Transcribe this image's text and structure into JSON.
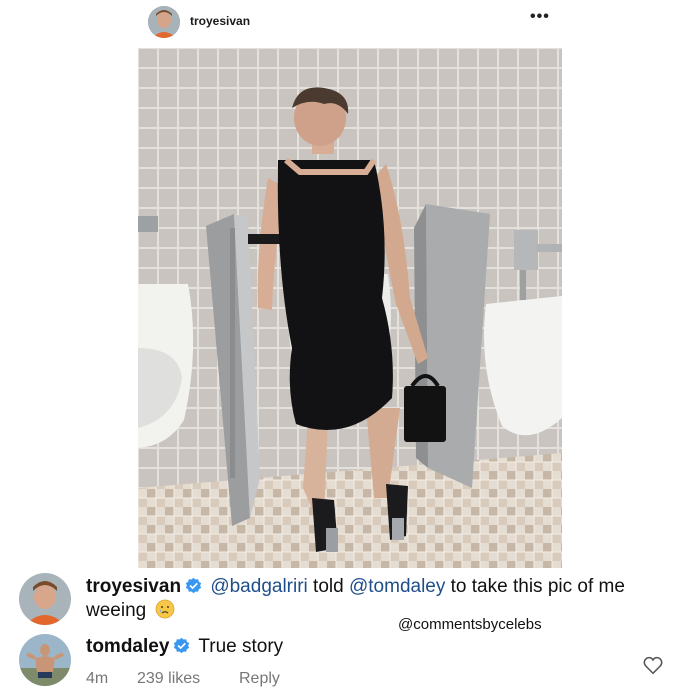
{
  "post": {
    "username": "troyesivan",
    "more_icon": "more-horizontal-icon",
    "more_label": "•••"
  },
  "comments": [
    {
      "username": "troyesivan",
      "verified": true,
      "text_parts": {
        "mention1": "@badgalriri",
        "mid": " told ",
        "mention2": "@tomdaley",
        "after": " to take this pic of me weeing"
      },
      "emoji": "crying-face-icon"
    },
    {
      "username": "tomdaley",
      "verified": true,
      "text": "True story",
      "time": "4m",
      "likes": "239 likes",
      "reply": "Reply"
    }
  ],
  "watermark": "@commentsbycelebs",
  "colors": {
    "verified_blue": "#3897f0",
    "mention": "#1f4f8a",
    "meta_gray": "#777777"
  }
}
